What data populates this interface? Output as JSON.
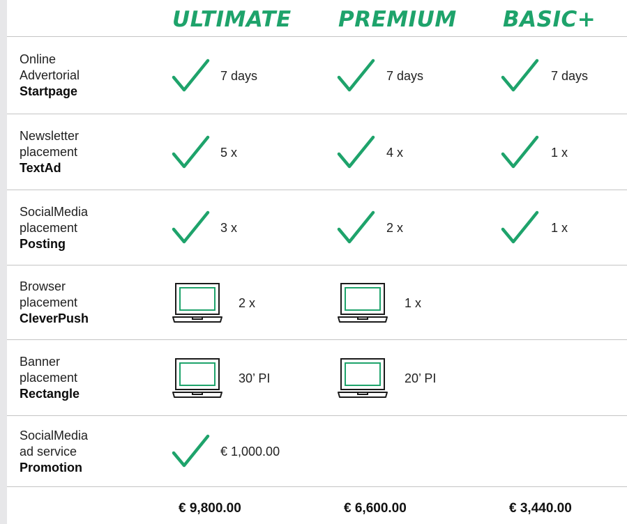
{
  "plans": [
    "ULTIMATE",
    "PREMIUM",
    "BASIC+"
  ],
  "accent_color": "#1ea36b",
  "rows": [
    {
      "feature": [
        "Online",
        "Advertorial",
        "Startpage"
      ],
      "cells": [
        {
          "icon": "check-icon",
          "value": "7 days"
        },
        {
          "icon": "check-icon",
          "value": "7 days"
        },
        {
          "icon": "check-icon",
          "value": "7 days"
        }
      ]
    },
    {
      "feature": [
        "Newsletter",
        "placement",
        "TextAd"
      ],
      "cells": [
        {
          "icon": "check-icon",
          "value": "5 x"
        },
        {
          "icon": "check-icon",
          "value": "4 x"
        },
        {
          "icon": "check-icon",
          "value": "1 x"
        }
      ]
    },
    {
      "feature": [
        "SocialMedia",
        "placement",
        "Posting"
      ],
      "cells": [
        {
          "icon": "check-icon",
          "value": "3 x"
        },
        {
          "icon": "check-icon",
          "value": "2 x"
        },
        {
          "icon": "check-icon",
          "value": "1 x"
        }
      ]
    },
    {
      "feature": [
        "Browser",
        "placement",
        "CleverPush"
      ],
      "cells": [
        {
          "icon": "laptop-icon",
          "value": "2 x"
        },
        {
          "icon": "laptop-icon",
          "value": "1 x"
        }
      ]
    },
    {
      "feature": [
        "Banner",
        "placement",
        "Rectangle"
      ],
      "cells": [
        {
          "icon": "laptop-icon",
          "value": "30’ PI"
        },
        {
          "icon": "laptop-icon",
          "value": "20’ PI"
        }
      ]
    },
    {
      "feature": [
        "SocialMedia",
        "ad service",
        "Promotion"
      ],
      "cells": [
        {
          "icon": "check-icon",
          "value": "€ 1,000.00"
        }
      ]
    }
  ],
  "prices": [
    "€ 9,800.00",
    "€ 6,600.00",
    "€ 3,440.00"
  ]
}
